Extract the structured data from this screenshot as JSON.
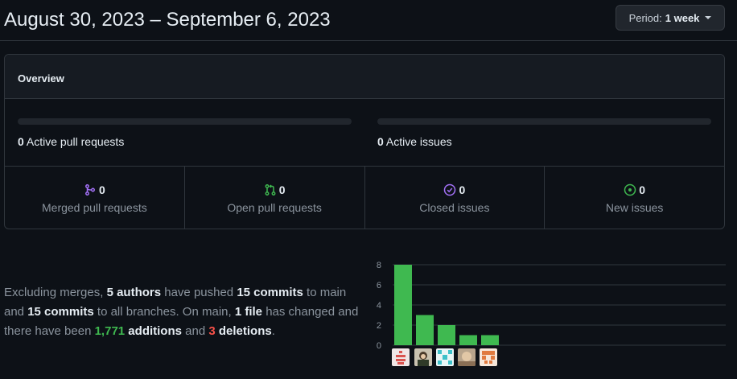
{
  "header": {
    "title": "August 30, 2023 – September 6, 2023",
    "period_label": "Period:",
    "period_value": "1 week"
  },
  "overview": {
    "title": "Overview",
    "pull_requests": {
      "count": "0",
      "label": "Active pull requests",
      "fill_fraction": 0
    },
    "issues": {
      "count": "0",
      "label": "Active issues",
      "fill_fraction": 0
    },
    "stats": [
      {
        "count": "0",
        "label": "Merged pull requests",
        "icon": "git-merge-icon",
        "color": "#a371f7"
      },
      {
        "count": "0",
        "label": "Open pull requests",
        "icon": "git-pull-request-icon",
        "color": "#3fb950"
      },
      {
        "count": "0",
        "label": "Closed issues",
        "icon": "issue-closed-icon",
        "color": "#a371f7"
      },
      {
        "count": "0",
        "label": "New issues",
        "icon": "issue-opened-icon",
        "color": "#3fb950"
      }
    ]
  },
  "summary": {
    "t1": "Excluding merges, ",
    "authors": "5 authors",
    "t2": " have pushed ",
    "commits_main": "15 commits",
    "t3": " to main and ",
    "commits_all": "15 commits",
    "t4": " to all branches. On main, ",
    "files": "1 file",
    "t5": " has changed and there have been ",
    "additions_num": "1,771",
    "additions_word": " additions",
    "t6": " and ",
    "deletions_num": "3",
    "deletions_word": " deletions",
    "t7": "."
  },
  "chart_data": {
    "type": "bar",
    "categories": [
      "author-1",
      "author-2",
      "author-3",
      "author-4",
      "author-5"
    ],
    "values": [
      8,
      3,
      2,
      1,
      1
    ],
    "ylim": [
      0,
      8
    ],
    "yticks": [
      0,
      2,
      4,
      6,
      8
    ],
    "bar_color": "#3fb950",
    "grid": true,
    "xlabel": "",
    "ylabel": "",
    "title": ""
  },
  "colors": {
    "background": "#0d1117",
    "border": "#30363d",
    "green": "#3fb950",
    "red": "#f85149",
    "purple": "#a371f7"
  }
}
